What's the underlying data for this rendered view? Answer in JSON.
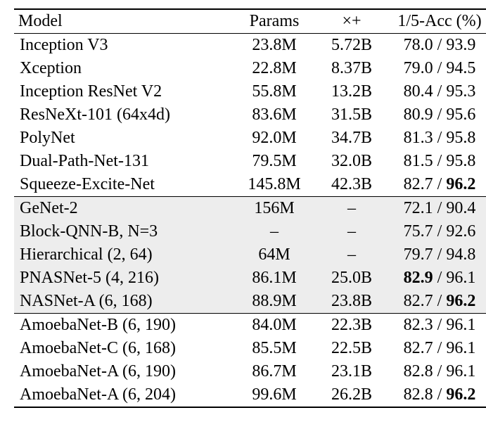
{
  "chart_data": {
    "type": "table",
    "columns": [
      "Model",
      "Params",
      "×+",
      "1/5-Acc (%)"
    ],
    "groups": [
      {
        "shaded": false,
        "rows": [
          {
            "model": "Inception V3",
            "params": "23.8M",
            "ops": "5.72B",
            "acc1": "78.0",
            "acc5": "93.9",
            "bold1": false,
            "bold5": false
          },
          {
            "model": "Xception",
            "params": "22.8M",
            "ops": "8.37B",
            "acc1": "79.0",
            "acc5": "94.5",
            "bold1": false,
            "bold5": false
          },
          {
            "model": "Inception ResNet V2",
            "params": "55.8M",
            "ops": "13.2B",
            "acc1": "80.4",
            "acc5": "95.3",
            "bold1": false,
            "bold5": false
          },
          {
            "model": "ResNeXt-101 (64x4d)",
            "params": "83.6M",
            "ops": "31.5B",
            "acc1": "80.9",
            "acc5": "95.6",
            "bold1": false,
            "bold5": false
          },
          {
            "model": "PolyNet",
            "params": "92.0M",
            "ops": "34.7B",
            "acc1": "81.3",
            "acc5": "95.8",
            "bold1": false,
            "bold5": false
          },
          {
            "model": "Dual-Path-Net-131",
            "params": "79.5M",
            "ops": "32.0B",
            "acc1": "81.5",
            "acc5": "95.8",
            "bold1": false,
            "bold5": false
          },
          {
            "model": "Squeeze-Excite-Net",
            "params": "145.8M",
            "ops": "42.3B",
            "acc1": "82.7",
            "acc5": "96.2",
            "bold1": false,
            "bold5": true
          }
        ]
      },
      {
        "shaded": true,
        "rows": [
          {
            "model": "GeNet-2",
            "params": "156M",
            "ops": "–",
            "acc1": "72.1",
            "acc5": "90.4",
            "bold1": false,
            "bold5": false
          },
          {
            "model": "Block-QNN-B, N=3",
            "params": "–",
            "ops": "–",
            "acc1": "75.7",
            "acc5": "92.6",
            "bold1": false,
            "bold5": false
          },
          {
            "model": "Hierarchical (2, 64)",
            "params": "64M",
            "ops": "–",
            "acc1": "79.7",
            "acc5": "94.8",
            "bold1": false,
            "bold5": false
          },
          {
            "model": "PNASNet-5 (4, 216)",
            "params": "86.1M",
            "ops": "25.0B",
            "acc1": "82.9",
            "acc5": "96.1",
            "bold1": true,
            "bold5": false
          },
          {
            "model": "NASNet-A (6, 168)",
            "params": "88.9M",
            "ops": "23.8B",
            "acc1": "82.7",
            "acc5": "96.2",
            "bold1": false,
            "bold5": true
          }
        ]
      },
      {
        "shaded": false,
        "rows": [
          {
            "model": "AmoebaNet-B (6, 190)",
            "params": "84.0M",
            "ops": "22.3B",
            "acc1": "82.3",
            "acc5": "96.1",
            "bold1": false,
            "bold5": false
          },
          {
            "model": "AmoebaNet-C (6, 168)",
            "params": "85.5M",
            "ops": "22.5B",
            "acc1": "82.7",
            "acc5": "96.1",
            "bold1": false,
            "bold5": false
          },
          {
            "model": "AmoebaNet-A (6, 190)",
            "params": "86.7M",
            "ops": "23.1B",
            "acc1": "82.8",
            "acc5": "96.1",
            "bold1": false,
            "bold5": false
          },
          {
            "model": "AmoebaNet-A (6, 204)",
            "params": "99.6M",
            "ops": "26.2B",
            "acc1": "82.8",
            "acc5": "96.2",
            "bold1": false,
            "bold5": true
          }
        ]
      }
    ]
  },
  "headers": {
    "model": "Model",
    "params": "Params",
    "ops": "×+",
    "acc": "1/5-Acc (%)"
  }
}
